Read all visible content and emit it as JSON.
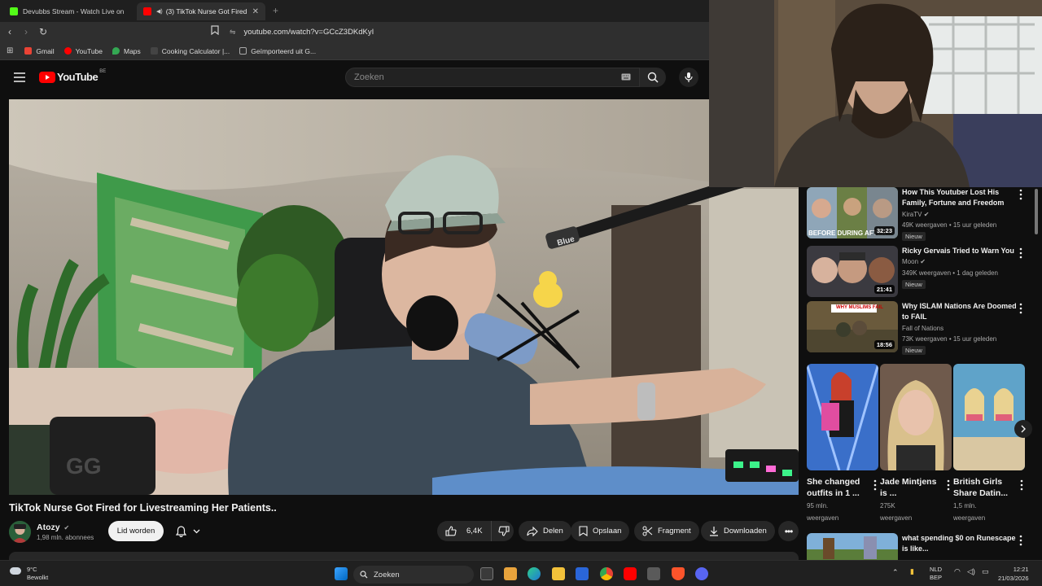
{
  "browser": {
    "tabs": [
      {
        "title": "Devubbs Stream - Watch Live on",
        "color": "#53fc18",
        "active": false
      },
      {
        "title": "(3) TikTok Nurse Got Fired for",
        "color": "#ff0000",
        "active": true
      }
    ],
    "new_tab": "+",
    "url": "youtube.com/watch?v=GCcZ3DKdKyI",
    "bookmarks": [
      {
        "label": "Gmail",
        "color": "#ea4335"
      },
      {
        "label": "YouTube",
        "color": "#ff0000"
      },
      {
        "label": "Maps",
        "color": "#34a853"
      },
      {
        "label": "Cooking Calculator |...",
        "color": "#444444"
      },
      {
        "label": "Geïmporteerd uit G...",
        "color": "#888888"
      }
    ]
  },
  "youtube": {
    "logo_text": "YouTube",
    "country_code": "BE",
    "search_placeholder": "Zoeken",
    "video": {
      "title": "TikTok Nurse Got Fired for Livestreaming Her Patients..",
      "mic_brand": "Blue",
      "channel": "Atozy",
      "subscribers": "1,98 mln. abonnees",
      "join_label": "Lid worden",
      "likes": "6,4K",
      "share_label": "Delen",
      "save_label": "Opslaan",
      "clip_label": "Fragment",
      "download_label": "Downloaden"
    },
    "related": [
      {
        "title": "How This Youtuber Lost His Family, Fortune and Freedom",
        "channel": "KiraTV",
        "verified": true,
        "meta": "49K weergaven • 15 uur geleden",
        "badge": "Nieuw",
        "duration": "32:23",
        "thumb_text": "BEFORE DURING AFTER"
      },
      {
        "title": "Ricky Gervais Tried to Warn You",
        "channel": "Moon",
        "verified": true,
        "meta": "349K weergaven • 1 dag geleden",
        "badge": "Nieuw",
        "duration": "21:41"
      },
      {
        "title": "Why ISLAM Nations Are Doomed to FAIL",
        "channel": "Fall of Nations",
        "verified": false,
        "meta": "73K weergaven • 15 uur geleden",
        "badge": "Nieuw",
        "duration": "18:56",
        "thumb_text": "WHY MUSLIMS FAIL"
      },
      {
        "title": "what spending $0 on Runescape is like...",
        "channel": "",
        "verified": false,
        "meta": "",
        "badge": "",
        "duration": ""
      }
    ],
    "shorts": [
      {
        "title": "She changed outfits in 1 ...",
        "views": "95 mln.",
        "views_suffix": "weergaven"
      },
      {
        "title": "Jade Mintjens is ...",
        "views": "275K",
        "views_suffix": "weergaven"
      },
      {
        "title": "British Girls Share Datin...",
        "views": "1,5 mln.",
        "views_suffix": "weergaven"
      }
    ]
  },
  "taskbar": {
    "weather_temp": "9°C",
    "weather_desc": "Bewolkt",
    "search_label": "Zoeken",
    "lang_top": "NLD",
    "lang_bottom": "BEP",
    "time": "12:21",
    "date": "21/03/2026"
  }
}
